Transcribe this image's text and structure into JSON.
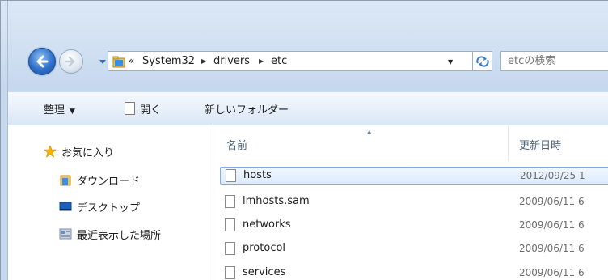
{
  "address": {
    "overflow": "«",
    "crumbs": [
      "System32",
      "drivers",
      "etc"
    ]
  },
  "search": {
    "placeholder": "etcの検索"
  },
  "toolbar": {
    "organize_label": "整理",
    "open_label": "開く",
    "new_folder_label": "新しいフォルダー"
  },
  "navpane": {
    "favorites_label": "お気に入り",
    "items": [
      {
        "label": "ダウンロード",
        "icon": "downloads-folder-icon"
      },
      {
        "label": "デスクトップ",
        "icon": "desktop-icon"
      },
      {
        "label": "最近表示した場所",
        "icon": "recent-places-icon"
      }
    ]
  },
  "filelist": {
    "columns": {
      "name": "名前",
      "modified": "更新日時"
    },
    "rows": [
      {
        "name": "hosts",
        "modified": "2012/09/25 1",
        "selected": true
      },
      {
        "name": "lmhosts.sam",
        "modified": "2009/06/11 6"
      },
      {
        "name": "networks",
        "modified": "2009/06/11 6"
      },
      {
        "name": "protocol",
        "modified": "2009/06/11 6"
      },
      {
        "name": "services",
        "modified": "2009/06/11 6"
      }
    ]
  },
  "colors": {
    "accent": "#2e6fc9",
    "selection_border": "#84acdd",
    "favorites_star": "#f4b400"
  }
}
